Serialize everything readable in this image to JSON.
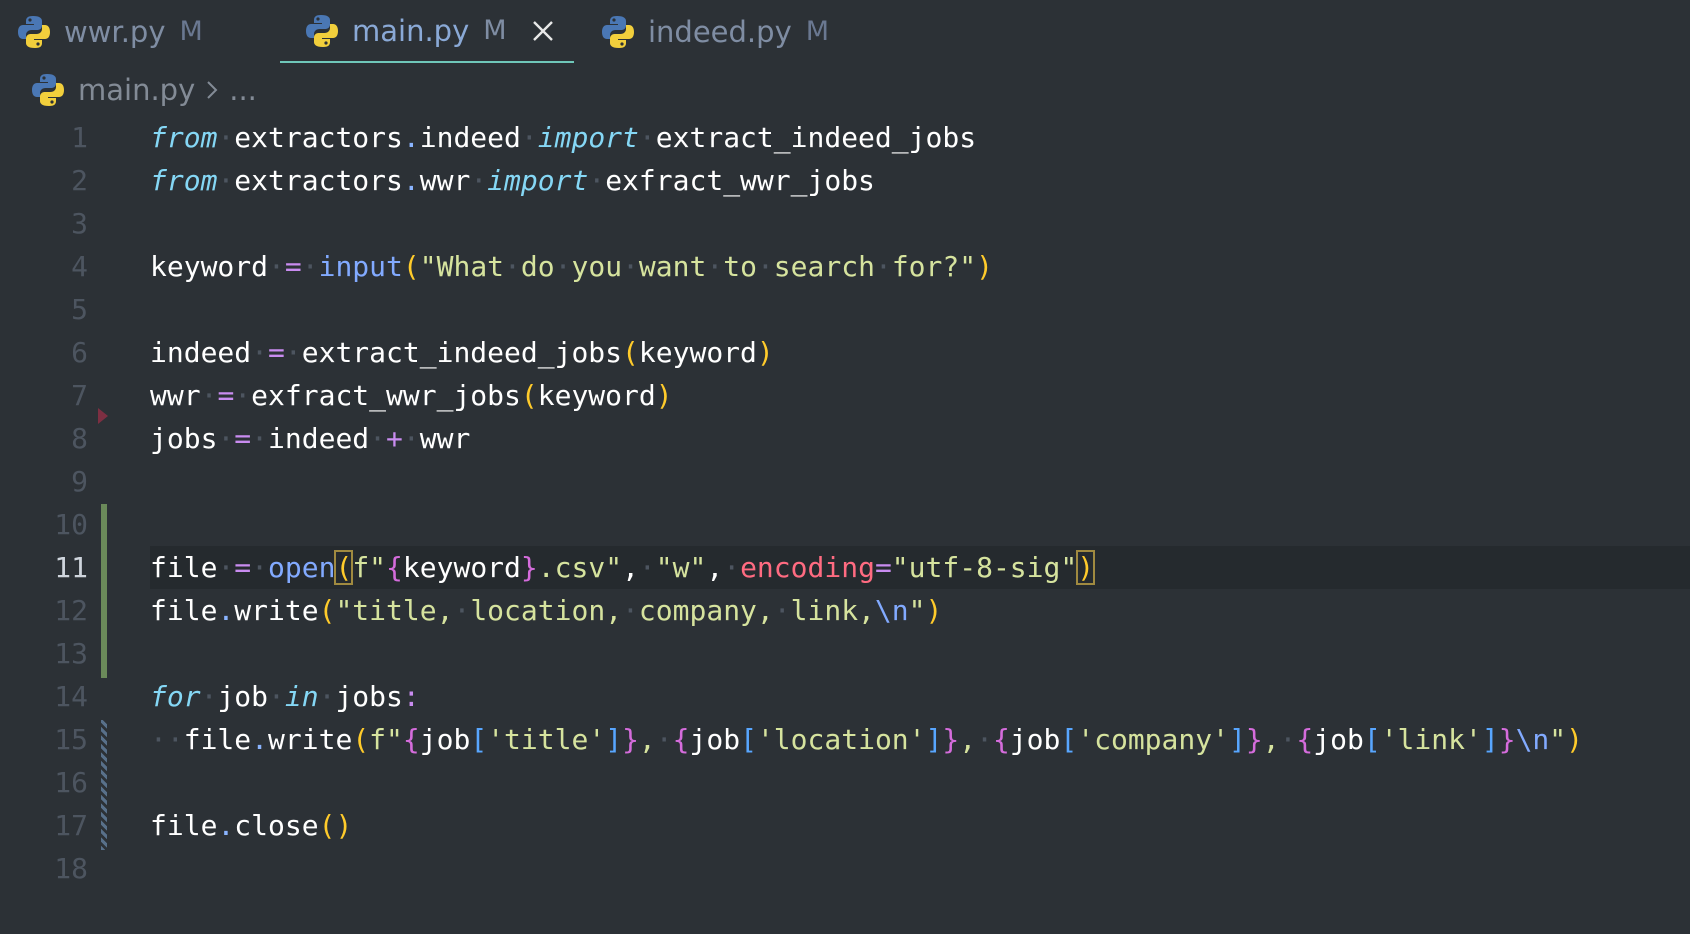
{
  "tabs": [
    {
      "label": "wwr.py",
      "status": "M",
      "active": false
    },
    {
      "label": "main.py",
      "status": "M",
      "active": true
    },
    {
      "label": "indeed.py",
      "status": "M",
      "active": false
    }
  ],
  "breadcrumb": {
    "file": "main.py",
    "rest": "..."
  },
  "editor": {
    "current_line": 11,
    "lines": [
      {
        "n": "1",
        "text": "from extractors.indeed import extract_indeed_jobs"
      },
      {
        "n": "2",
        "text": "from extractors.wwr import exfract_wwr_jobs"
      },
      {
        "n": "3",
        "text": ""
      },
      {
        "n": "4",
        "text": "keyword = input(\"What do you want to search for?\")"
      },
      {
        "n": "5",
        "text": ""
      },
      {
        "n": "6",
        "text": "indeed = extract_indeed_jobs(keyword)"
      },
      {
        "n": "7",
        "text": "wwr = exfract_wwr_jobs(keyword)"
      },
      {
        "n": "8",
        "text": "jobs = indeed + wwr"
      },
      {
        "n": "9",
        "text": ""
      },
      {
        "n": "10",
        "text": ""
      },
      {
        "n": "11",
        "text": "file = open(f\"{keyword}.csv\", \"w\", encoding=\"utf-8-sig\")"
      },
      {
        "n": "12",
        "text": "file.write(\"title, location, company, link,\\n\")"
      },
      {
        "n": "13",
        "text": ""
      },
      {
        "n": "14",
        "text": "for job in jobs:"
      },
      {
        "n": "15",
        "text": "  file.write(f\"{job['title']}, {job['location']}, {job['company']}, {job['link']}\\n\")"
      },
      {
        "n": "16",
        "text": ""
      },
      {
        "n": "17",
        "text": "file.close()"
      },
      {
        "n": "18",
        "text": ""
      }
    ]
  },
  "colors": {
    "background": "#2c3136",
    "keyword": "#85d7f5",
    "string": "#d6e39e",
    "function": "#82aaff",
    "operator": "#c98cf0",
    "bracket": "#ffcb2b",
    "param": "#ff6b81",
    "tab_underline": "#6fc7b9"
  },
  "icons": {
    "file_icon": "python-icon",
    "close_icon": "close-icon",
    "chevron": "chevron-right-icon"
  }
}
